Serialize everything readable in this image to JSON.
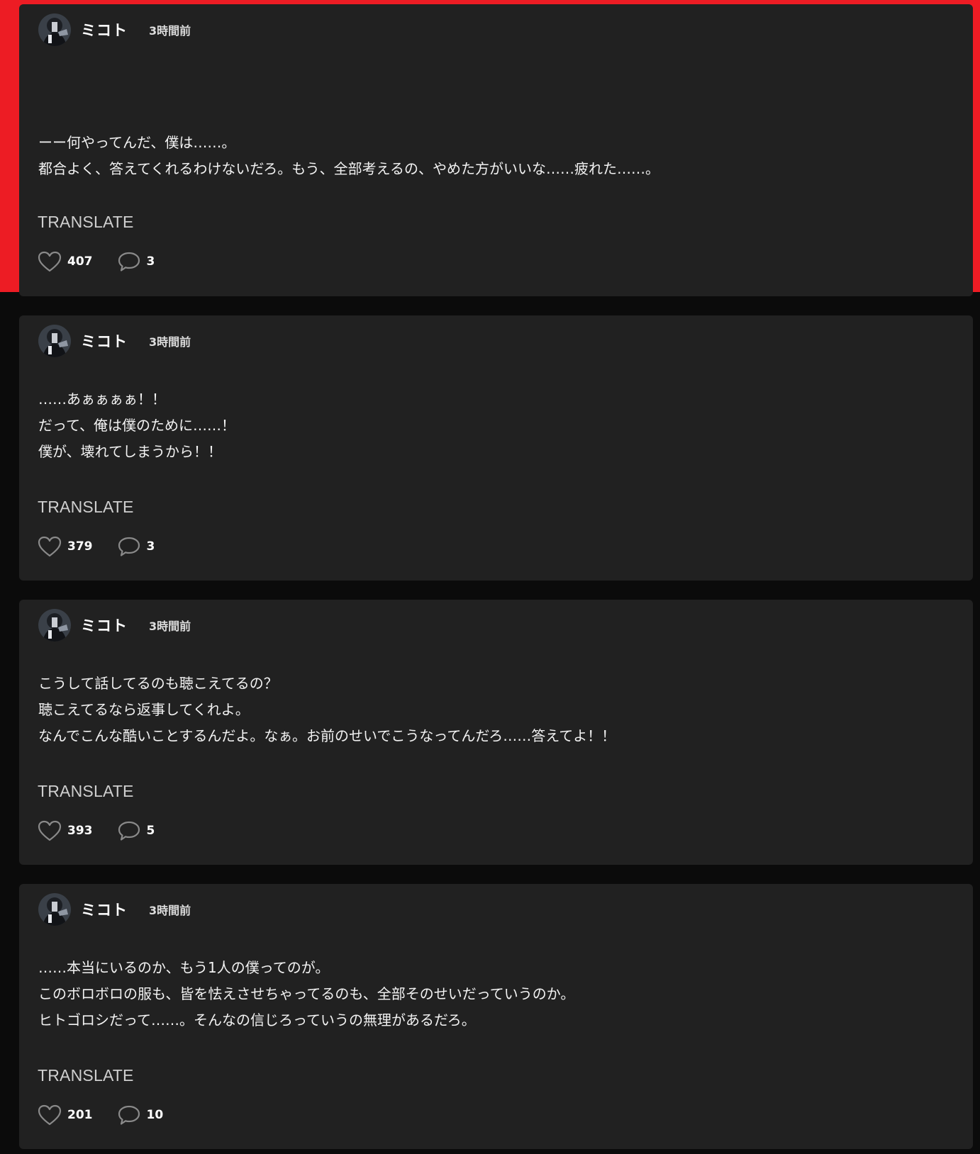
{
  "colors": {
    "page_background": "#0b0b0b",
    "card_background": "#212121",
    "highlight_border": "#ed1c24",
    "text_primary": "#ffffff",
    "text_secondary": "#cfcfcf"
  },
  "posts": [
    {
      "author": "ミコト",
      "time": "3時間前",
      "highlighted": true,
      "lines": [
        "ーー何やってんだ、僕は……。",
        "都合よく、答えてくれるわけないだろ。もう、全部考えるの、やめた方がいいな……疲れた……。"
      ],
      "translate_label": "TRANSLATE",
      "likes": "407",
      "comments": "3",
      "like_icon": "heart-outline-icon",
      "comment_icon": "speech-bubble-icon"
    },
    {
      "author": "ミコト",
      "time": "3時間前",
      "highlighted": false,
      "lines": [
        "……あぁぁぁぁ！！",
        "だって、俺は僕のために……！",
        "僕が、壊れてしまうから！！"
      ],
      "translate_label": "TRANSLATE",
      "likes": "379",
      "comments": "3",
      "like_icon": "heart-outline-icon",
      "comment_icon": "speech-bubble-icon"
    },
    {
      "author": "ミコト",
      "time": "3時間前",
      "highlighted": false,
      "lines": [
        "こうして話してるのも聴こえてるの？",
        "聴こえてるなら返事してくれよ。",
        "なんでこんな酷いことするんだよ。なぁ。お前のせいでこうなってんだろ……答えてよ！！"
      ],
      "translate_label": "TRANSLATE",
      "likes": "393",
      "comments": "5",
      "like_icon": "heart-outline-icon",
      "comment_icon": "speech-bubble-icon"
    },
    {
      "author": "ミコト",
      "time": "3時間前",
      "highlighted": false,
      "lines": [
        "……本当にいるのか、もう1人の僕ってのが。",
        "このボロボロの服も、皆を怯えさせちゃってるのも、全部そのせいだっていうのか。",
        "ヒトゴロシだって……。そんなの信じろっていうの無理があるだろ。"
      ],
      "translate_label": "TRANSLATE",
      "likes": "201",
      "comments": "10",
      "like_icon": "heart-outline-icon",
      "comment_icon": "speech-bubble-icon"
    }
  ]
}
